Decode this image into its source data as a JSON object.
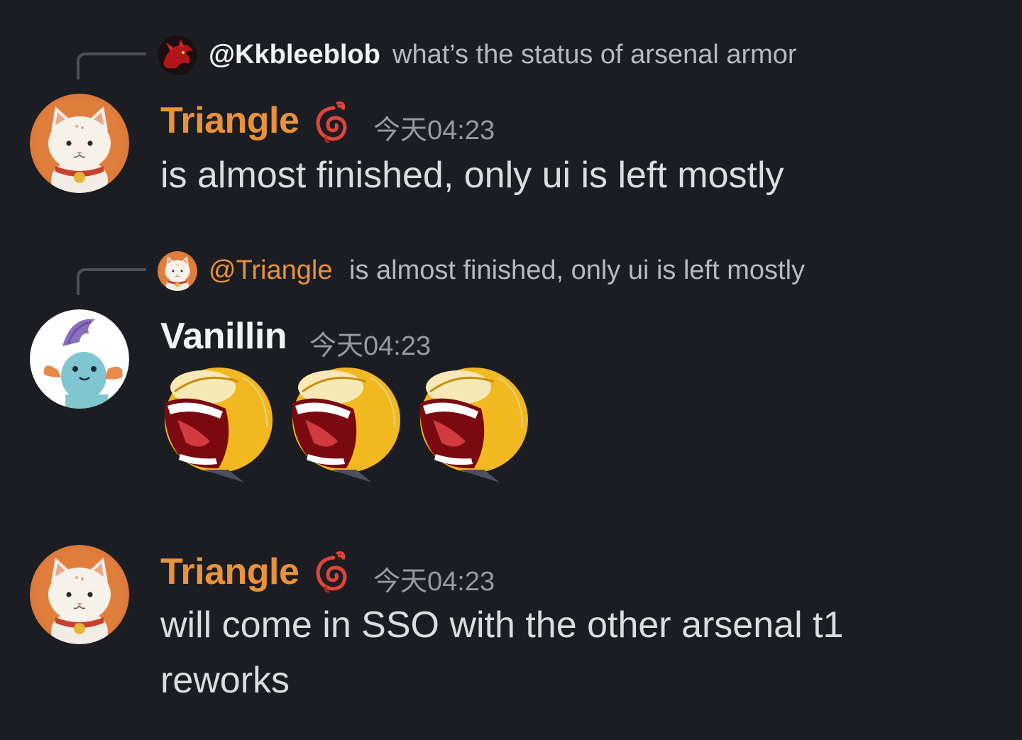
{
  "colors": {
    "background": "#1c1d22",
    "triangle_name": "#e8923a",
    "default_name": "#f2f3f5",
    "mention": "#e8923a",
    "timestamp": "#949ba4",
    "body_text": "#dbdee1"
  },
  "messages": [
    {
      "reply": {
        "avatar_icon": "red-dragon-icon",
        "author": "@Kkbleeblob",
        "text": "what’s the status of arsenal armor"
      },
      "avatar_icon": "white-cat-avatar",
      "author": "Triangle",
      "role_icon": "red-spiral-role-icon",
      "timestamp": "今天04:23",
      "content": "is almost finished, only ui is left mostly"
    },
    {
      "reply": {
        "avatar_icon": "white-cat-avatar",
        "author": "@Triangle",
        "text": "is almost finished, only ui is left mostly"
      },
      "avatar_icon": "mudkip-avatar",
      "author": "Vanillin",
      "timestamp": "今天04:23",
      "emojis": [
        "laughing-emoji",
        "laughing-emoji",
        "laughing-emoji"
      ]
    },
    {
      "avatar_icon": "white-cat-avatar",
      "author": "Triangle",
      "role_icon": "red-spiral-role-icon",
      "timestamp": "今天04:23",
      "content": "will come in SSO with the other arsenal t1 reworks"
    }
  ]
}
